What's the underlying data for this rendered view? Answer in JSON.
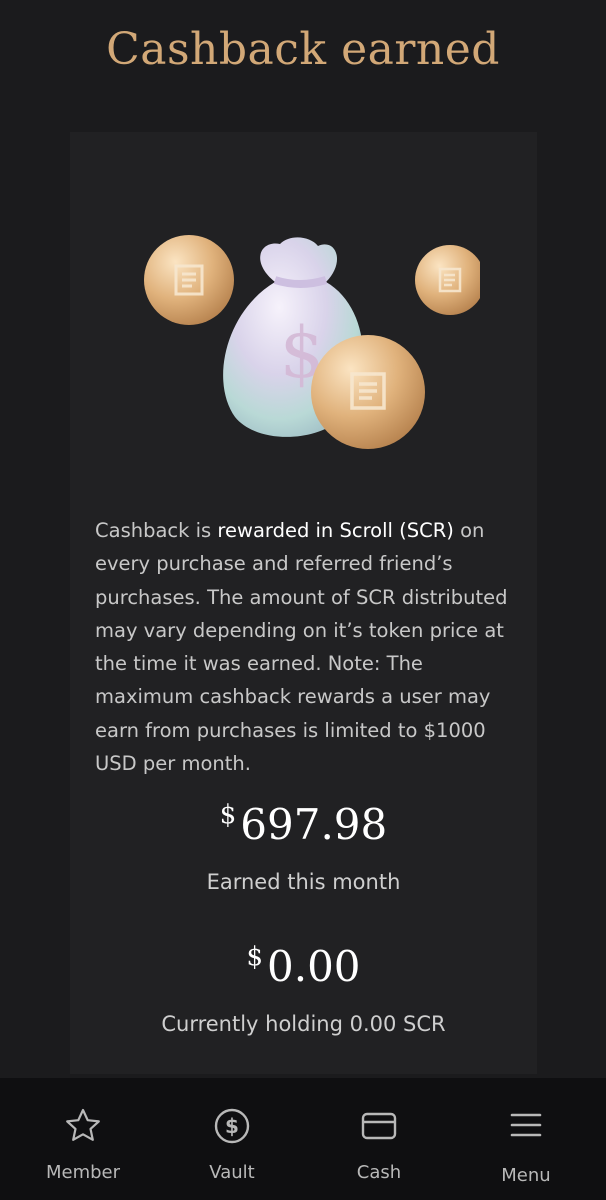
{
  "header": {
    "title": "Cashback earned"
  },
  "card": {
    "description_before": "Cashback is ",
    "description_highlight": "rewarded in Scroll (SCR)",
    "description_after": " on every purchase and referred friend’s purchases. The amount of SCR distributed may vary depending on it’s token price at the time it was earned. Note: The maximum cashback rewards a user may earn from purchases is limited to $1000 USD per month.",
    "month": {
      "currency": "$",
      "value": "697.98",
      "label": "Earned this month"
    },
    "holding": {
      "currency": "$",
      "value": "0.00",
      "label": "Currently holding 0.00 SCR"
    }
  },
  "nav": {
    "items": [
      {
        "label": "Member",
        "icon": "star-icon"
      },
      {
        "label": "Vault",
        "icon": "dollar-circle-icon"
      },
      {
        "label": "Cash",
        "icon": "card-icon"
      },
      {
        "label": "Menu",
        "icon": "hamburger-icon"
      }
    ]
  },
  "colors": {
    "background": "#1b1b1d",
    "card": "#212123",
    "title": "#d2a877",
    "nav_background": "#0f0f11"
  }
}
